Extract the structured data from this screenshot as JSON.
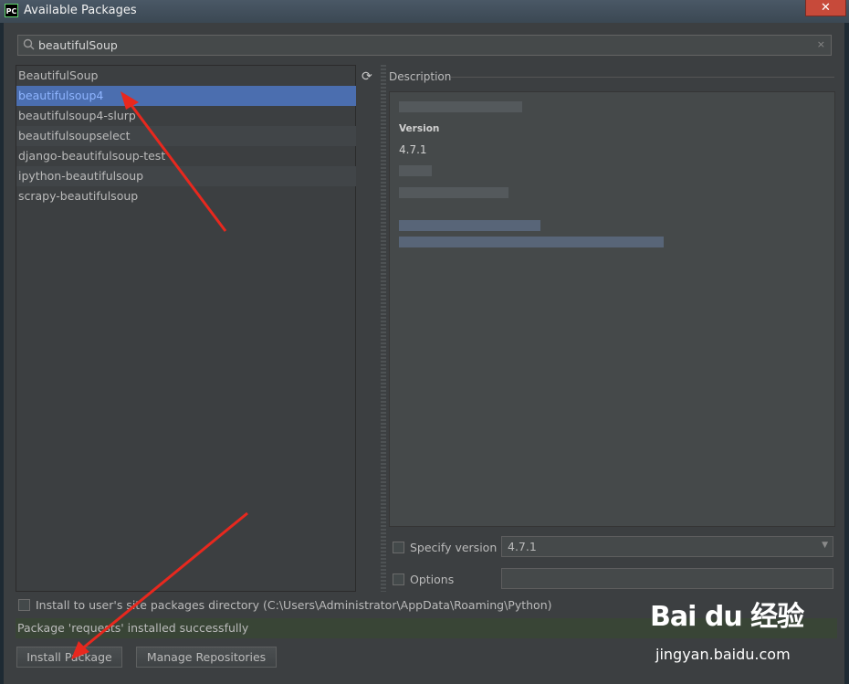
{
  "window": {
    "title": "Available Packages",
    "app_icon": "PC",
    "close_glyph": "✕"
  },
  "search": {
    "value": "beautifulSoup",
    "icon": "search-icon",
    "clear_glyph": "×"
  },
  "packages": [
    {
      "name": "BeautifulSoup",
      "selected": false
    },
    {
      "name": "beautifulsoup4",
      "selected": true
    },
    {
      "name": "beautifulsoup4-slurp",
      "selected": false
    },
    {
      "name": "beautifulsoupselect",
      "selected": false
    },
    {
      "name": "django-beautifulsoup-test",
      "selected": false
    },
    {
      "name": "ipython-beautifulsoup",
      "selected": false
    },
    {
      "name": "scrapy-beautifulsoup",
      "selected": false
    }
  ],
  "refresh_glyph": "⟳",
  "description": {
    "label": "Description",
    "version_label": "Version",
    "version_value": "4.7.1"
  },
  "specify_version": {
    "label": "Specify version",
    "checked": false,
    "value": "4.7.1",
    "arrow": "▼"
  },
  "options": {
    "label": "Options",
    "checked": false,
    "value": ""
  },
  "install_user_site": {
    "label": "Install to user's site packages directory (C:\\Users\\Administrator\\AppData\\Roaming\\Python)",
    "checked": false
  },
  "status": {
    "text": "Package 'requests' installed successfully",
    "color": "#394536"
  },
  "buttons": {
    "install": "Install Package",
    "manage": "Manage Repositories"
  },
  "watermark": {
    "logo": "Bai du 经验",
    "url": "jingyan.baidu.com"
  },
  "colors": {
    "selection": "#4b6eaf",
    "annotation_arrow": "#e8281e"
  }
}
